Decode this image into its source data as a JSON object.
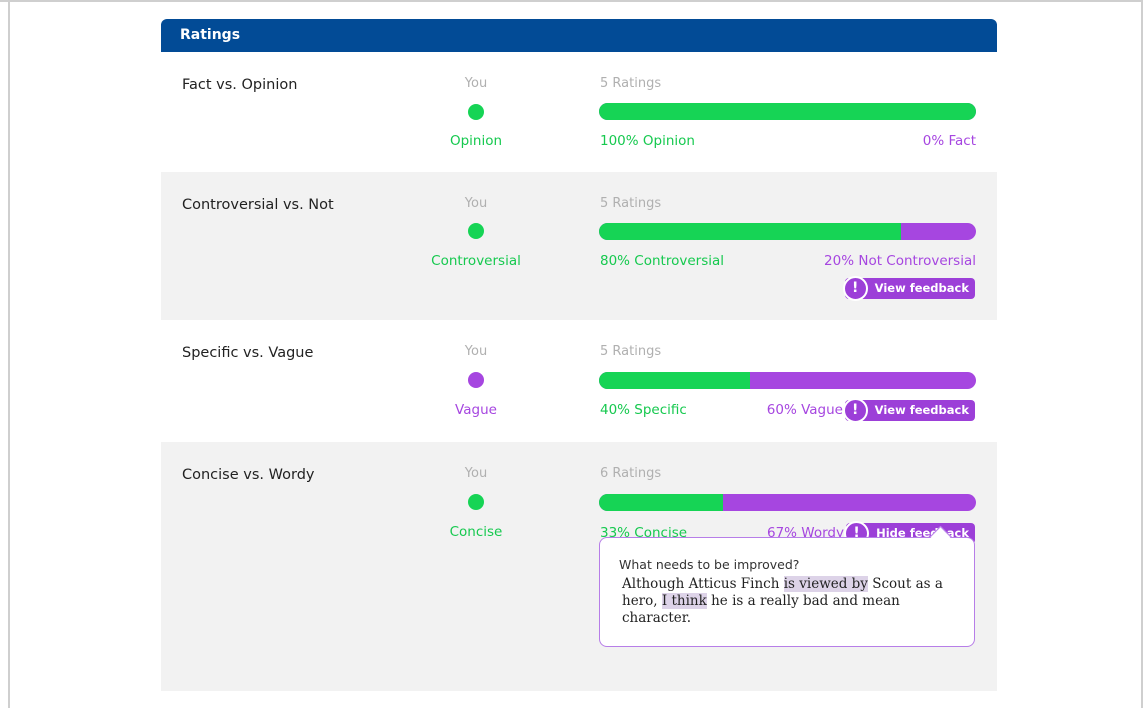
{
  "panel": {
    "title": "Ratings"
  },
  "rows": [
    {
      "title": "Fact vs. Opinion",
      "you_label": "You",
      "you_value": "Opinion",
      "ratings_count": "5 Ratings",
      "left_fraction": 1.0,
      "left_pct": "100% Opinion",
      "right_pct": "0% Fact"
    },
    {
      "title": "Controversial vs. Not",
      "you_label": "You",
      "you_value": "Controversial",
      "ratings_count": "5 Ratings",
      "left_fraction": 0.8,
      "left_pct": "80% Controversial",
      "right_pct": "20% Not Controversial",
      "feedback_button": "View feedback"
    },
    {
      "title": "Specific vs. Vague",
      "you_label": "You",
      "you_value": "Vague",
      "ratings_count": "5 Ratings",
      "left_fraction": 0.4,
      "left_pct": "40% Specific",
      "right_pct": "60% Vague",
      "feedback_button": "View feedback"
    },
    {
      "title": "Concise vs. Wordy",
      "you_label": "You",
      "you_value": "Concise",
      "ratings_count": "6 Ratings",
      "left_fraction": 0.33,
      "left_pct": "33% Concise",
      "right_pct": "67% Wordy",
      "feedback_button": "Hide feedback",
      "feedback": {
        "prompt": "What needs to be improved?",
        "text_parts": [
          "Although Atticus Finch ",
          "is viewed by",
          " Scout as a hero, ",
          "I think",
          " he is a really bad and mean character."
        ]
      }
    }
  ],
  "icons": {
    "alert": "!"
  },
  "colors": {
    "header": "#024b96",
    "green": "#16d455",
    "purple": "#a646e0"
  }
}
